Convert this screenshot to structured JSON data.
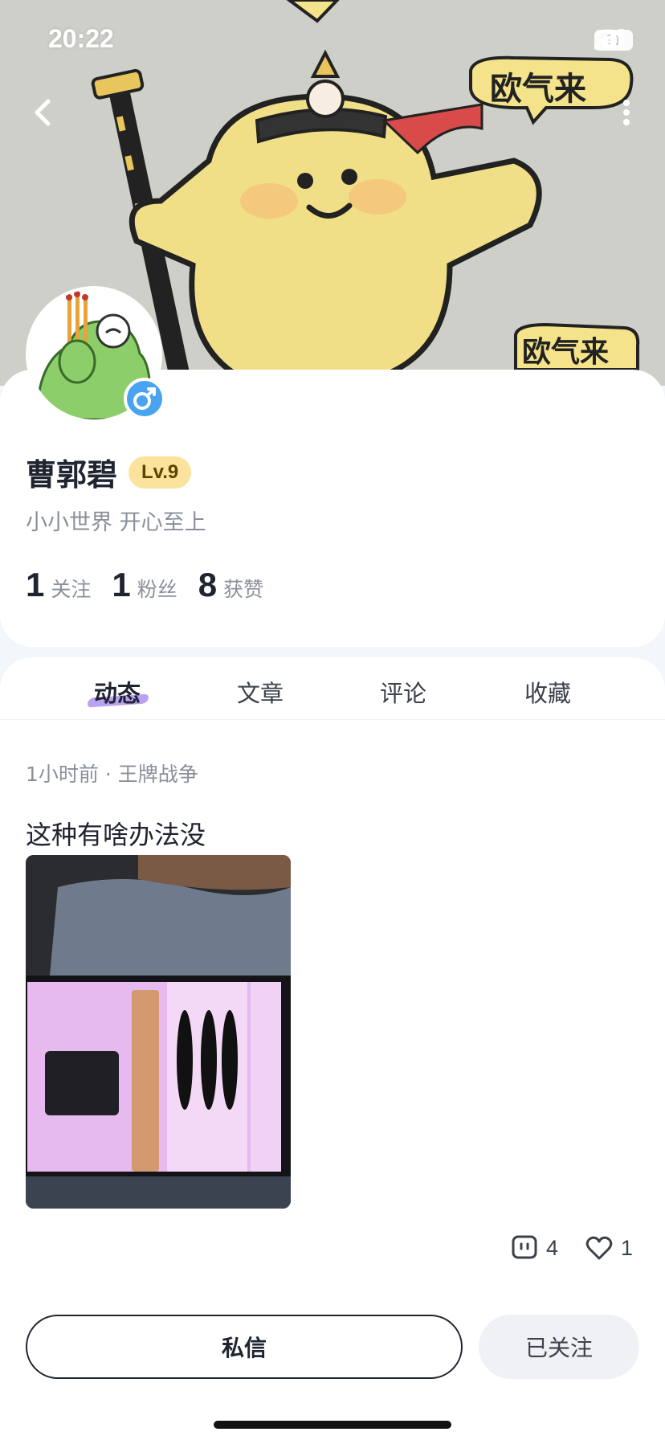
{
  "status_bar": {
    "time": "20:22",
    "battery": "31"
  },
  "banner": {
    "sticker_text_top": "欧气来",
    "sticker_text_bottom": "欧气来"
  },
  "icons": {
    "back": "chevron-left-icon",
    "more": "more-vertical-icon",
    "gender": "male-icon",
    "comment": "comment-icon",
    "like": "heart-icon"
  },
  "profile": {
    "name": "曹郭碧",
    "level": "Lv.9",
    "bio": "小小世界 开心至上",
    "stats": [
      {
        "num": "1",
        "label": "关注"
      },
      {
        "num": "1",
        "label": "粉丝"
      },
      {
        "num": "8",
        "label": "获赞"
      }
    ]
  },
  "tabs": [
    "动态",
    "文章",
    "评论",
    "收藏"
  ],
  "post": {
    "meta": "1小时前 · 王牌战争",
    "text": "这种有啥办法没",
    "comments": "4",
    "likes": "1"
  },
  "actions": {
    "dm": "私信",
    "follow": "已关注"
  }
}
